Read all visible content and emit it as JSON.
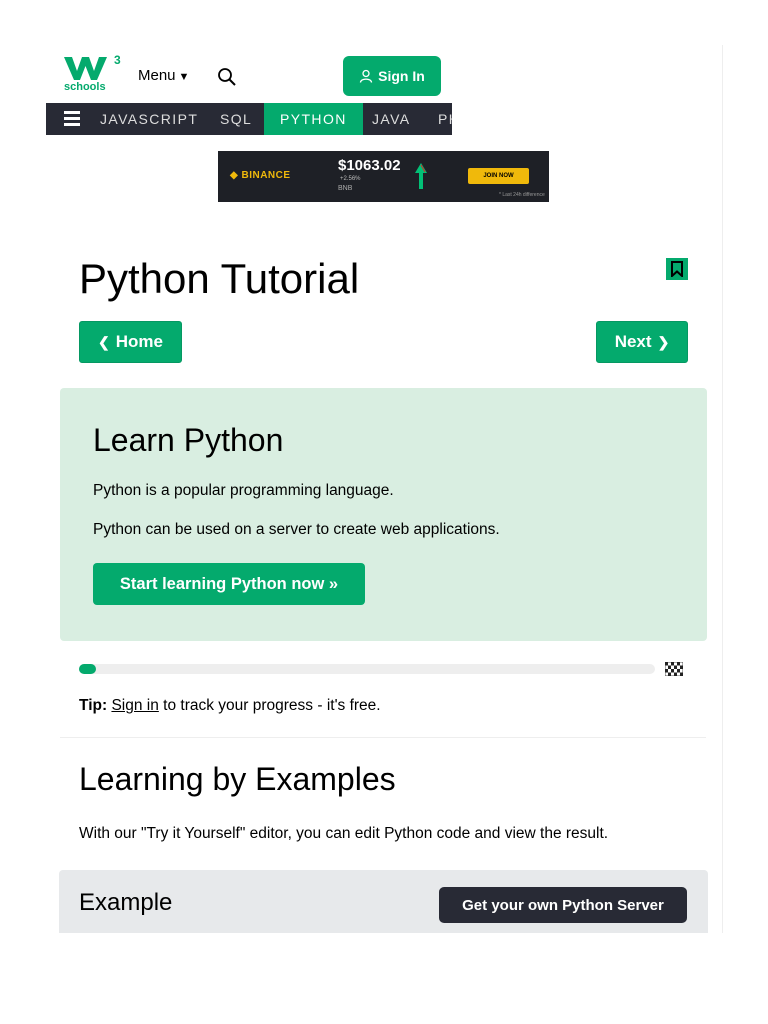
{
  "header": {
    "logo_text": "schools",
    "logo_sup": "3",
    "menu_label": "Menu",
    "signin_label": "Sign In"
  },
  "nav": {
    "items": [
      "JAVASCRIPT",
      "SQL",
      "PYTHON",
      "JAVA",
      "PHP"
    ],
    "active": "PYTHON"
  },
  "ad": {
    "brand": "BINANCE",
    "price": "$1063.02",
    "change": "+2.56%",
    "coin": "BNB",
    "cta": "JOIN NOW",
    "footnote": "* Last 24h difference"
  },
  "page": {
    "title": "Python Tutorial",
    "home_label": "Home",
    "next_label": "Next"
  },
  "hero": {
    "heading": "Learn Python",
    "line1": "Python is a popular programming language.",
    "line2": "Python can be used on a server to create web applications.",
    "cta": "Start learning Python now »"
  },
  "progress": {
    "fraction": 0.03
  },
  "tip": {
    "bold": "Tip:",
    "link": "Sign in",
    "rest": " to track your progress - it's free."
  },
  "examples": {
    "heading": "Learning by Examples",
    "intro": "With our \"Try it Yourself\" editor, you can edit Python code and view the result.",
    "box_label": "Example",
    "server_button": "Get your own Python Server"
  },
  "colors": {
    "accent": "#04aa6d",
    "nav_bg": "#282a35",
    "hero_bg": "#d9eee1"
  }
}
